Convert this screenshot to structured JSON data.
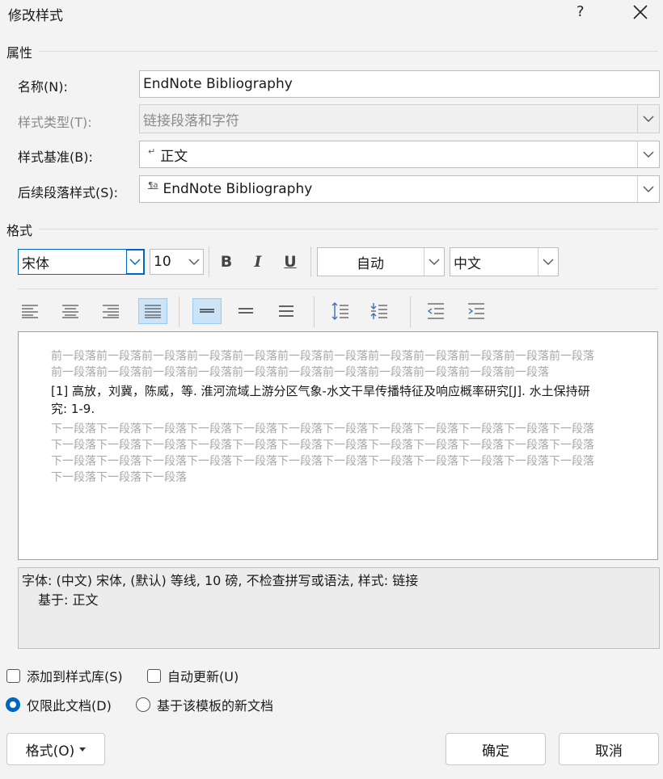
{
  "dialog": {
    "title": "修改样式",
    "help": "?"
  },
  "properties": {
    "section_label": "属性",
    "name_label": "名称(N):",
    "name_value": "EndNote Bibliography",
    "style_type_label": "样式类型(T):",
    "style_type_value": "链接段落和字符",
    "based_on_label": "样式基准(B):",
    "based_on_glyph": "↵",
    "based_on_value": "正文",
    "next_style_label": "后续段落样式(S):",
    "next_style_glyph": "¶a",
    "next_style_value": "EndNote Bibliography"
  },
  "format": {
    "section_label": "格式",
    "font_name": "宋体",
    "font_size": "10",
    "bold": "B",
    "italic": "I",
    "underline": "U",
    "color": "自动",
    "script": "中文"
  },
  "preview": {
    "before": "前一段落前一段落前一段落前一段落前一段落前一段落前一段落前一段落前一段落前一段落前一段落前一段落前一段落前一段落前一段落前一段落前一段落前一段落前一段落前一段落前一段落前一段落前一段落",
    "main": "[1]  高放，刘冀，陈威，等. 淮河流域上游分区气象-水文干旱传播特征及响应概率研究[J]. 水土保持研究: 1-9.",
    "after": "下一段落下一段落下一段落下一段落下一段落下一段落下一段落下一段落下一段落下一段落下一段落下一段落下一段落下一段落下一段落下一段落下一段落下一段落下一段落下一段落下一段落下一段落下一段落下一段落下一段落下一段落下一段落下一段落下一段落下一段落下一段落下一段落下一段落下一段落下一段落下一段落下一段落下一段落下一段落"
  },
  "description": {
    "line1": "字体: (中文) 宋体, (默认) 等线, 10 磅, 不检查拼写或语法, 样式: 链接",
    "line2": "基于: 正文"
  },
  "options": {
    "add_to_gallery": "添加到样式库(S)",
    "auto_update": "自动更新(U)",
    "this_document": "仅限此文档(D)",
    "new_documents": "基于该模板的新文档"
  },
  "buttons": {
    "format": "格式(O)",
    "ok": "确定",
    "cancel": "取消"
  },
  "colors": {
    "accent": "#0067c0",
    "selected_bg": "#cce4f7"
  }
}
